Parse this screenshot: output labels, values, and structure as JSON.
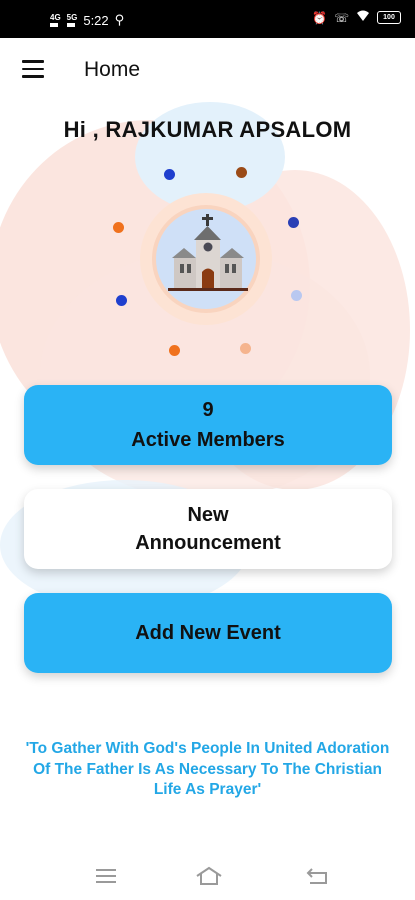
{
  "status_bar": {
    "network_1": "4G",
    "network_2": "5G",
    "time": "5:22",
    "battery": "100"
  },
  "app_bar": {
    "title": "Home"
  },
  "greeting": "Hi , RAJKUMAR APSALOM",
  "members_card": {
    "count": "9",
    "label": "Active Members"
  },
  "announcement_card": {
    "line1": "New",
    "line2": "Announcement"
  },
  "event_card": {
    "label": "Add New Event"
  },
  "quote": "'To Gather With God's People In United Adoration Of The Father Is As Necessary To The Christian Life As Prayer'",
  "colors": {
    "accent_blue": "#2ab3f5",
    "quote_blue": "#23a7e6",
    "blob_pink": "#fbe5df",
    "blob_blue": "#e3f1fb"
  },
  "icons": [
    "menu-icon",
    "church-icon",
    "nav-recents-icon",
    "nav-home-icon",
    "nav-back-icon"
  ]
}
